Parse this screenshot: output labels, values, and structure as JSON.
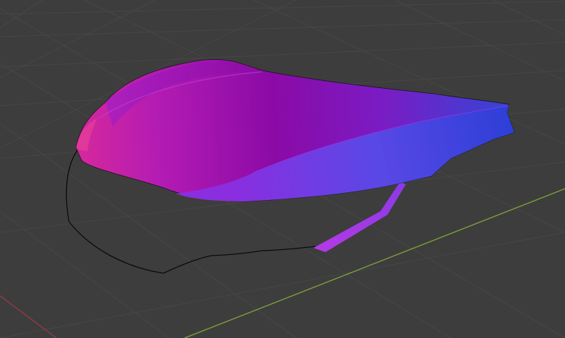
{
  "viewport": {
    "background": "#3d3d3d",
    "grid_color": "#474747",
    "grid_minor_color": "#424242",
    "x_axis_color": "#8c3a45",
    "y_axis_color": "#7a9a3a"
  },
  "mesh": {
    "name": "",
    "gradient_colors": [
      "#d02a9a",
      "#a21ab5",
      "#8a0ea8",
      "#7a2cd6",
      "#3f55e0",
      "#2f3fd8"
    ],
    "outline_color": "#0a0a0a"
  }
}
